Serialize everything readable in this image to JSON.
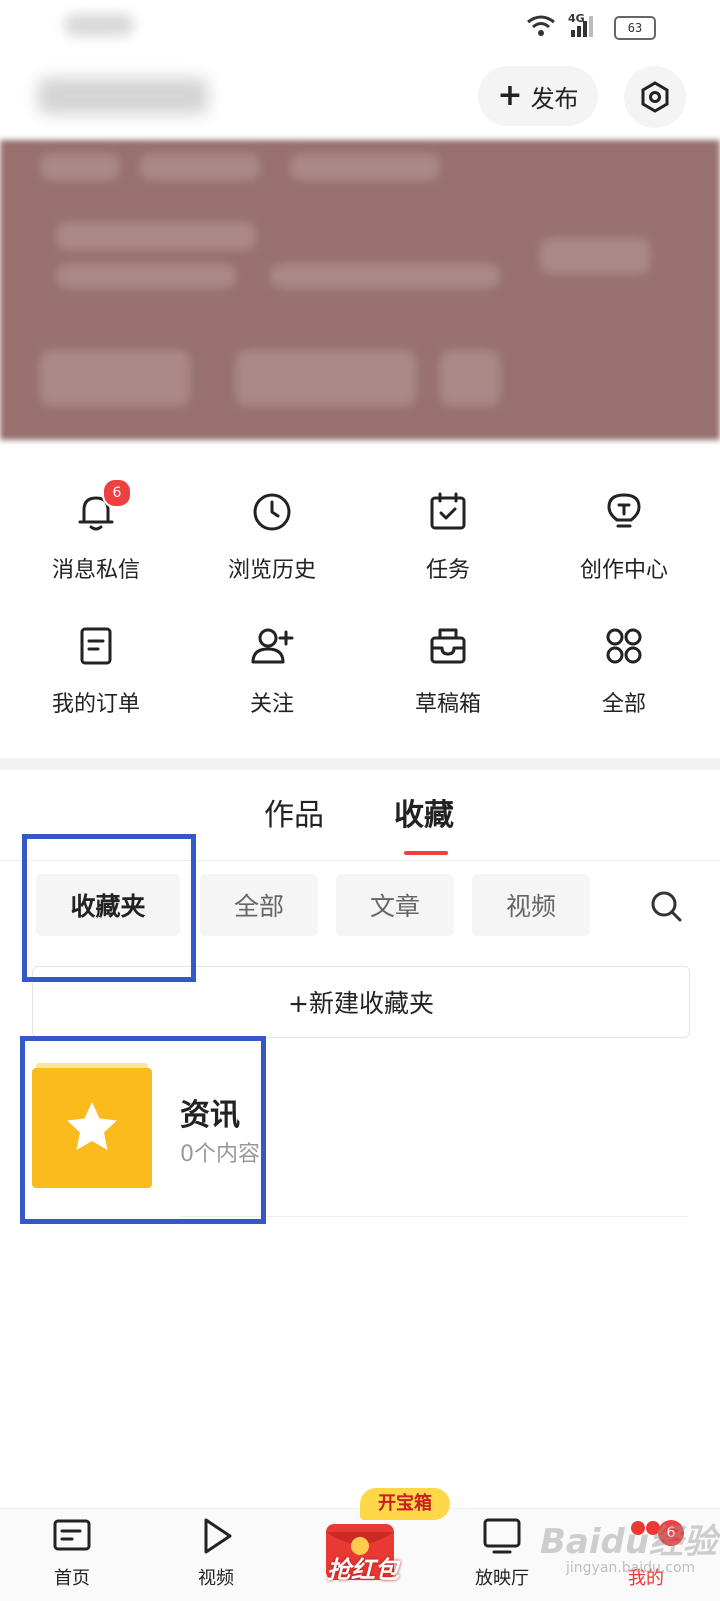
{
  "status_bar": {
    "network": "4G",
    "battery": "63"
  },
  "header": {
    "publish_label": "发布"
  },
  "quick_actions": [
    {
      "label": "消息私信",
      "icon": "bell-icon",
      "badge": "6"
    },
    {
      "label": "浏览历史",
      "icon": "clock-icon"
    },
    {
      "label": "任务",
      "icon": "calendar-check-icon"
    },
    {
      "label": "创作中心",
      "icon": "lightbulb-icon"
    },
    {
      "label": "我的订单",
      "icon": "document-icon"
    },
    {
      "label": "关注",
      "icon": "user-add-icon"
    },
    {
      "label": "草稿箱",
      "icon": "drafts-box-icon"
    },
    {
      "label": "全部",
      "icon": "grid-icon"
    }
  ],
  "content_tabs": {
    "items": [
      "作品",
      "收藏"
    ],
    "active": "收藏"
  },
  "filter_chips": {
    "items": [
      "收藏夹",
      "全部",
      "文章",
      "视频"
    ],
    "active": "收藏夹"
  },
  "new_folder_label": "+新建收藏夹",
  "folder": {
    "title": "资讯",
    "count": "0个内容"
  },
  "bottom_nav": {
    "home": "首页",
    "video": "视频",
    "hongbao": "抢红包",
    "hongbao_tag": "开宝箱",
    "theater": "放映厅",
    "mine": "我的",
    "mine_badge": "6"
  },
  "watermark": {
    "text": "Baidu经验",
    "sub": "jingyan.baidu.com"
  },
  "colors": {
    "accent": "#f04142",
    "highlight_box": "#3558c8",
    "folder_yellow": "#fbbb1c",
    "banner": "#97706f"
  }
}
